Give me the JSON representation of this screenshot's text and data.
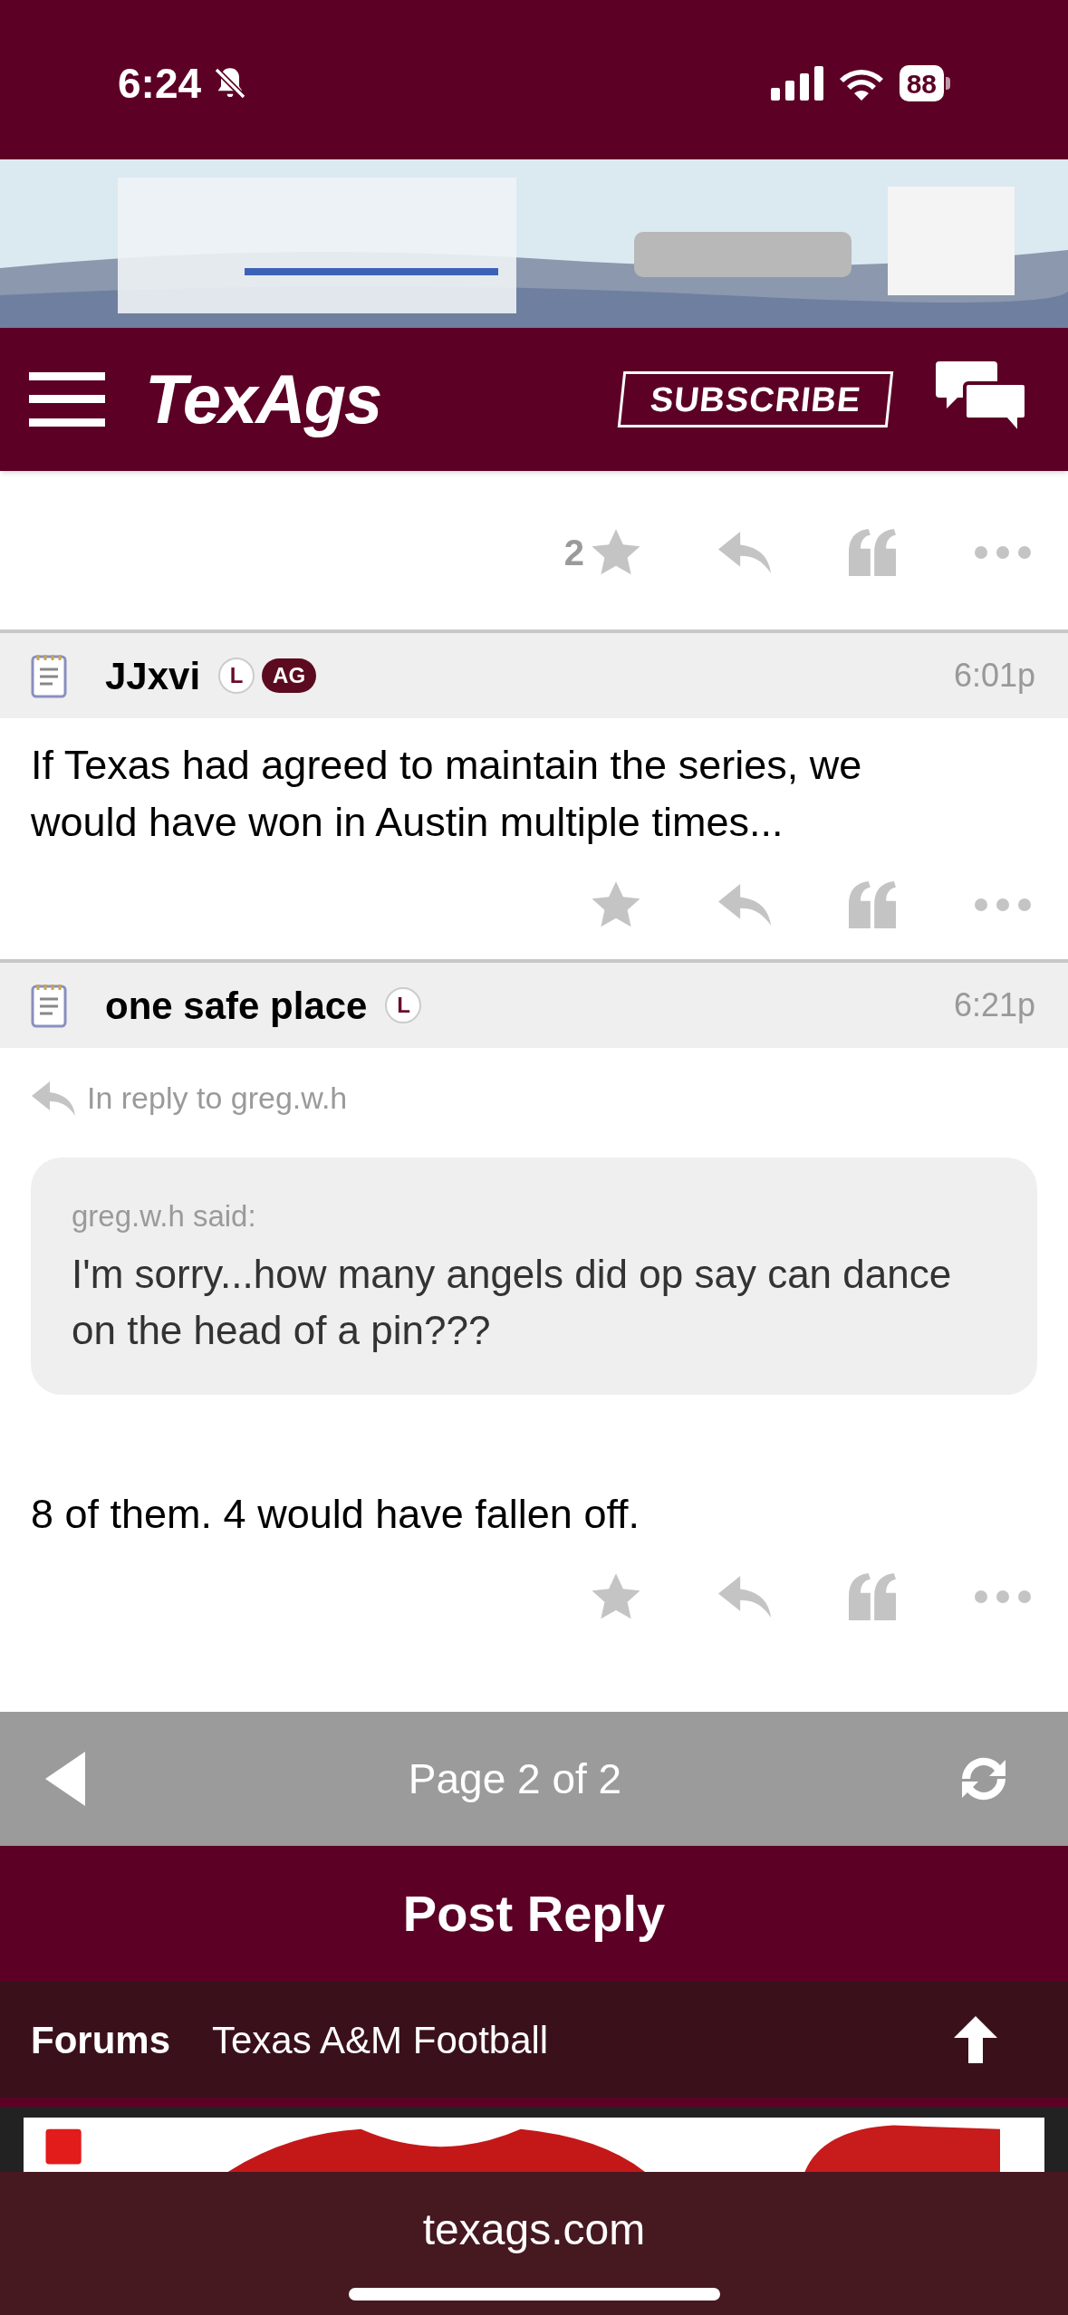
{
  "status_bar": {
    "time": "6:24",
    "battery": "88"
  },
  "nav": {
    "logo": "TexAgs",
    "subscribe": "SUBSCRIBE"
  },
  "posts": [
    {
      "stars_count": "2"
    },
    {
      "header": {
        "user": "JJxvi",
        "badges": [
          {
            "kind": "outline",
            "label": "L"
          },
          {
            "kind": "filled",
            "label": "AG"
          }
        ],
        "time": "6:01p"
      },
      "body": "If Texas had agreed to maintain the series, we would have won in Austin multiple times..."
    },
    {
      "header": {
        "user": "one safe place",
        "badges": [
          {
            "kind": "outline",
            "label": "L"
          }
        ],
        "time": "6:21p"
      },
      "in_reply_to": "In reply to greg.w.h",
      "quote": {
        "author": "greg.w.h said:",
        "text": "I'm sorry...how many angels did op say can dance on the head of a pin???"
      },
      "body": "8 of them. 4 would have fallen off."
    }
  ],
  "pager": {
    "label": "Page 2 of 2"
  },
  "post_reply": "Post Reply",
  "breadcrumb": {
    "root": "Forums",
    "current": "Texas A&M Football"
  },
  "browser": {
    "url": "texags.com"
  }
}
